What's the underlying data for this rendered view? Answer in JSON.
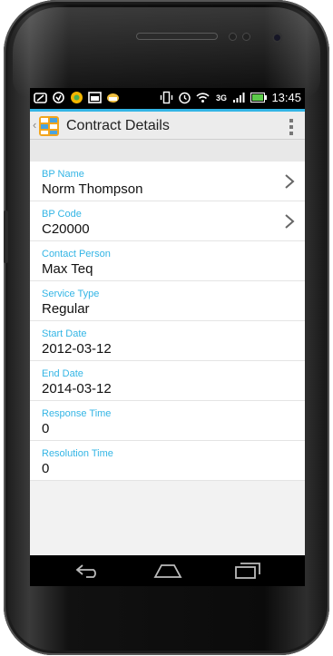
{
  "status_bar": {
    "time": "13:45",
    "network": "3G",
    "left_icons": [
      "screenshot-icon",
      "sync-icon",
      "vpn-icon",
      "gallery-icon",
      "cloud-icon"
    ],
    "right_icons": [
      "vibrate-icon",
      "alarm-icon",
      "wifi-icon",
      "data-icon",
      "signal-icon",
      "battery-icon"
    ]
  },
  "app_bar": {
    "title": "Contract Details"
  },
  "fields": [
    {
      "label": "BP Name",
      "value": "Norm Thompson",
      "has_chevron": true
    },
    {
      "label": "BP Code",
      "value": "C20000",
      "has_chevron": true
    },
    {
      "label": "Contact Person",
      "value": "Max Teq",
      "has_chevron": false
    },
    {
      "label": "Service Type",
      "value": "Regular",
      "has_chevron": false
    },
    {
      "label": "Start Date",
      "value": "2012-03-12",
      "has_chevron": false
    },
    {
      "label": "End Date",
      "value": "2014-03-12",
      "has_chevron": false
    },
    {
      "label": "Response Time",
      "value": "0",
      "has_chevron": false
    },
    {
      "label": "Resolution Time",
      "value": "0",
      "has_chevron": false
    }
  ],
  "nav_bar": {
    "buttons": [
      "back-icon",
      "home-icon",
      "recents-icon"
    ]
  },
  "colors": {
    "accent": "#33b5e5",
    "appbar_bg": "#ececec",
    "status_bg": "#000000"
  }
}
